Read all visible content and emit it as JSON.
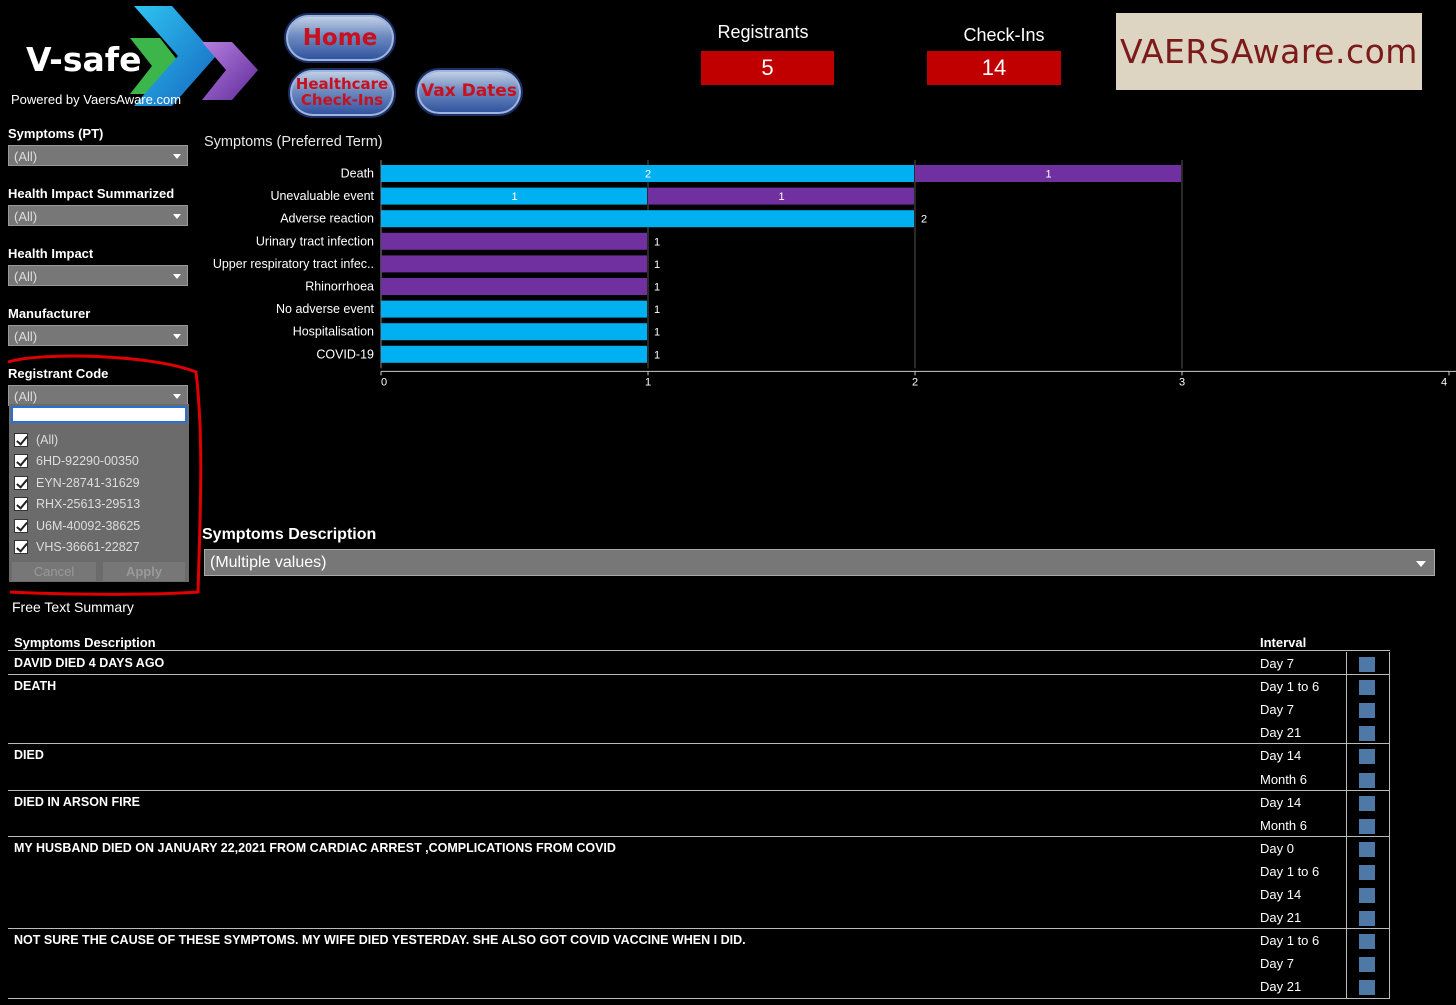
{
  "header": {
    "logo_title": "V-safe",
    "powered_by": "Powered by VaersAware.com",
    "nav": {
      "home": "Home",
      "healthcare_line1": "Healthcare",
      "healthcare_line2": "Check-Ins",
      "vax_dates": "Vax Dates"
    },
    "kpis": [
      {
        "label": "Registrants",
        "value": "5"
      },
      {
        "label": "Check-Ins",
        "value": "14"
      }
    ],
    "brand": "VAERSAware.com"
  },
  "filters": {
    "symptoms_pt": {
      "label": "Symptoms (PT)",
      "value": "(All)"
    },
    "health_impact_summarized": {
      "label": "Health Impact Summarized",
      "value": "(All)"
    },
    "health_impact": {
      "label": "Health Impact",
      "value": "(All)"
    },
    "manufacturer": {
      "label": "Manufacturer",
      "value": "(All)"
    },
    "registrant_code": {
      "label": "Registrant Code",
      "value": "(All)",
      "search_value": "",
      "options": [
        "(All)",
        "6HD-92290-00350",
        "EYN-28741-31629",
        "RHX-25613-29513",
        "U6M-40092-38625",
        "VHS-36661-22827"
      ],
      "cancel": "Cancel",
      "apply": "Apply"
    }
  },
  "chart_data": {
    "type": "bar",
    "orientation": "horizontal",
    "stacked": true,
    "title": "Symptoms (Preferred Term)",
    "categories": [
      "Death",
      "Unevaluable event",
      "Adverse reaction",
      "Urinary tract infection",
      "Upper respiratory tract infec..",
      "Rhinorrhoea",
      "No adverse event",
      "Hospitalisation",
      "COVID-19"
    ],
    "series": [
      {
        "color": "#00b0f0",
        "values": [
          2,
          1,
          2,
          0,
          0,
          0,
          1,
          1,
          1
        ]
      },
      {
        "color": "#7030a0",
        "values": [
          1,
          1,
          0,
          1,
          1,
          1,
          0,
          0,
          0
        ]
      }
    ],
    "xlim": [
      0,
      4
    ],
    "xticks": [
      "0",
      "1",
      "2",
      "3",
      "4"
    ],
    "grid": true
  },
  "symptoms_description": {
    "title": "Symptoms Description",
    "value": "(Multiple values)"
  },
  "free_text": {
    "title": "Free Text Summary",
    "col_desc": "Symptoms Description",
    "col_interval": "Interval",
    "rows": [
      {
        "desc": "DAVID DIED 4 DAYS AGO",
        "intervals": [
          "Day 7"
        ]
      },
      {
        "desc": "DEATH",
        "intervals": [
          "Day 1 to 6",
          "Day 7",
          "Day 21"
        ]
      },
      {
        "desc": "DIED",
        "intervals": [
          "Day 14",
          "Month 6"
        ]
      },
      {
        "desc": "DIED IN ARSON FIRE",
        "intervals": [
          "Day 14",
          "Month 6"
        ]
      },
      {
        "desc": "MY HUSBAND DIED ON JANUARY 22,2021 FROM CARDIAC ARREST ,COMPLICATIONS FROM COVID",
        "intervals": [
          "Day 0",
          "Day 1 to 6",
          "Day 14",
          "Day 21"
        ]
      },
      {
        "desc": "NOT SURE THE CAUSE OF THESE SYMPTOMS. MY WIFE DIED YESTERDAY. SHE ALSO GOT COVID VACCINE WHEN I DID.",
        "intervals": [
          "Day 1 to 6",
          "Day 7",
          "Day 21"
        ]
      }
    ]
  },
  "colors": {
    "kpi_box": "#c00000",
    "bar_blue": "#00b0f0",
    "bar_purple": "#7030a0",
    "mark_square": "#4e79a7",
    "highlight_outline": "#e00000"
  }
}
